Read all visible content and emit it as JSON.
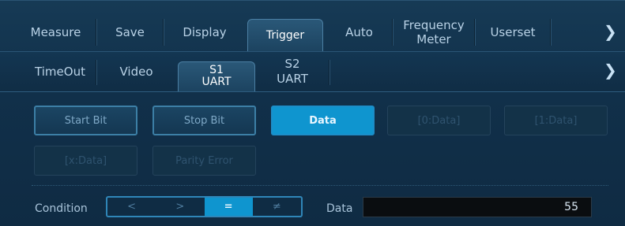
{
  "top_tabs": [
    {
      "label": "Measure"
    },
    {
      "label": "Save"
    },
    {
      "label": "Display"
    },
    {
      "label": "Trigger"
    },
    {
      "label": "Auto"
    },
    {
      "label_line1": "Frequency",
      "label_line2": "Meter"
    },
    {
      "label": "Userset"
    }
  ],
  "top_chevron": "❯",
  "sub_tabs": [
    {
      "label": "TimeOut"
    },
    {
      "label": "Video"
    },
    {
      "label_line1": "S1",
      "label_line2": "UART"
    },
    {
      "label_line1": "S2",
      "label_line2": "UART"
    }
  ],
  "sub_chevron": "❯",
  "trigger_buttons": [
    {
      "label": "Start Bit",
      "state": "enabled"
    },
    {
      "label": "Stop Bit",
      "state": "enabled"
    },
    {
      "label": "Data",
      "state": "selected"
    },
    {
      "label": "[0:Data]",
      "state": "disabled"
    },
    {
      "label": "[1:Data]",
      "state": "disabled"
    },
    {
      "label": "[x:Data]",
      "state": "disabled"
    },
    {
      "label": "Parity Error",
      "state": "disabled"
    }
  ],
  "condition": {
    "label": "Condition",
    "options": [
      "<",
      ">",
      "=",
      "≠"
    ],
    "selected": "="
  },
  "data_field": {
    "label": "Data",
    "value": "55"
  },
  "colors": {
    "accent": "#0f95cf",
    "background": "#11304a"
  }
}
